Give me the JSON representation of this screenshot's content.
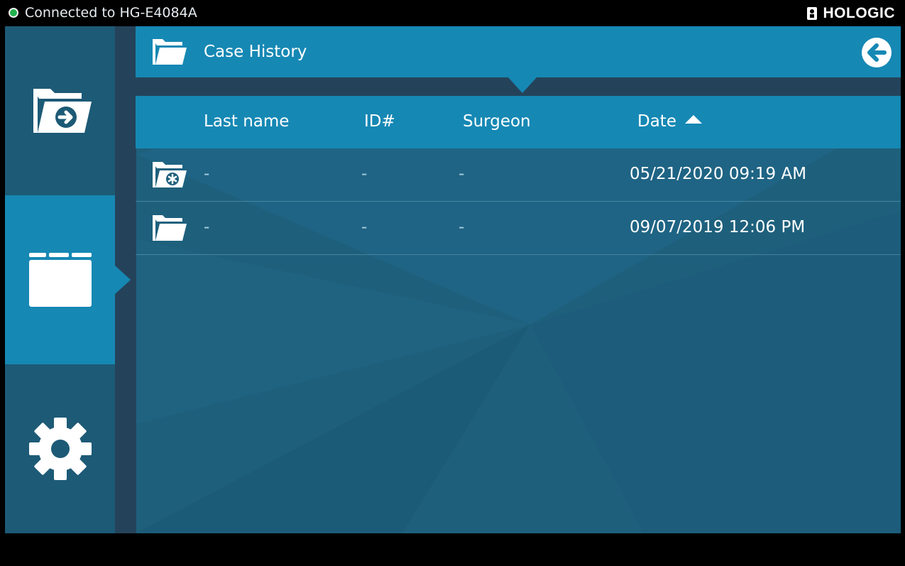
{
  "status_bar": {
    "connection_text": "Connected to HG-E4084A",
    "connection_color": "#22b24c",
    "brand": "HOLOGIC"
  },
  "nav": {
    "items": [
      {
        "name": "open-case",
        "icon": "folder-arrow-icon",
        "active": false
      },
      {
        "name": "case-history",
        "icon": "folder-icon",
        "active": true
      },
      {
        "name": "settings",
        "icon": "gear-icon",
        "active": false
      }
    ]
  },
  "header": {
    "title": "Case History",
    "icon": "open-folder-icon",
    "back_icon": "back-arrow-icon"
  },
  "table": {
    "columns": {
      "last_name": "Last name",
      "id": "ID#",
      "surgeon": "Surgeon",
      "date": "Date"
    },
    "sort": {
      "column": "date",
      "direction": "ascending"
    },
    "rows": [
      {
        "icon": "folder-asterisk-icon",
        "last_name": "-",
        "id": "-",
        "surgeon": "-",
        "date": "05/21/2020 09:19 AM"
      },
      {
        "icon": "open-folder-icon",
        "last_name": "-",
        "id": "-",
        "surgeon": "-",
        "date": "09/07/2019 12:06 PM"
      }
    ]
  },
  "colors": {
    "accent": "#1688b4",
    "panel": "#1e607c",
    "rail": "#24435a"
  }
}
